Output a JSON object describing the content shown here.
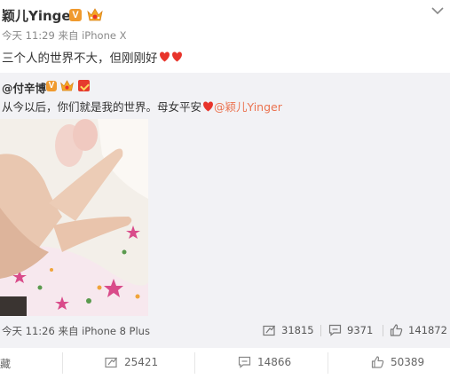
{
  "post": {
    "username": "颖儿Yinger",
    "verified_badge": "V",
    "time": "今天 11:29",
    "source_prefix": "来自",
    "source": "iPhone X",
    "text": "三个人的世界不大，但刚刚好"
  },
  "repost": {
    "username": "@付辛博",
    "verified_badge": "V",
    "text": "从今以后，你们就是我的世界。母女平安",
    "mention": "@颖儿Yinger",
    "time": "今天 11:26",
    "source_prefix": "来自",
    "source": "iPhone 8 Plus",
    "stats": {
      "reposts": "31815",
      "comments": "9371",
      "likes": "141872"
    }
  },
  "actions": {
    "favorite_label": "收藏",
    "repost_count": "25421",
    "comment_count": "14866",
    "like_count": "50389"
  },
  "icons": {
    "caret": "chevron-down-icon",
    "heart": "heart-emoji-icon",
    "repost": "repost-icon",
    "comment": "comment-icon",
    "like": "thumbs-up-icon",
    "crown": "vip-crown-icon",
    "badge": "red-badge-icon"
  },
  "colors": {
    "verified": "#f09a2e",
    "mention": "#eb7350",
    "heart": "#e8342b",
    "repost_bg": "#f2f2f5"
  }
}
